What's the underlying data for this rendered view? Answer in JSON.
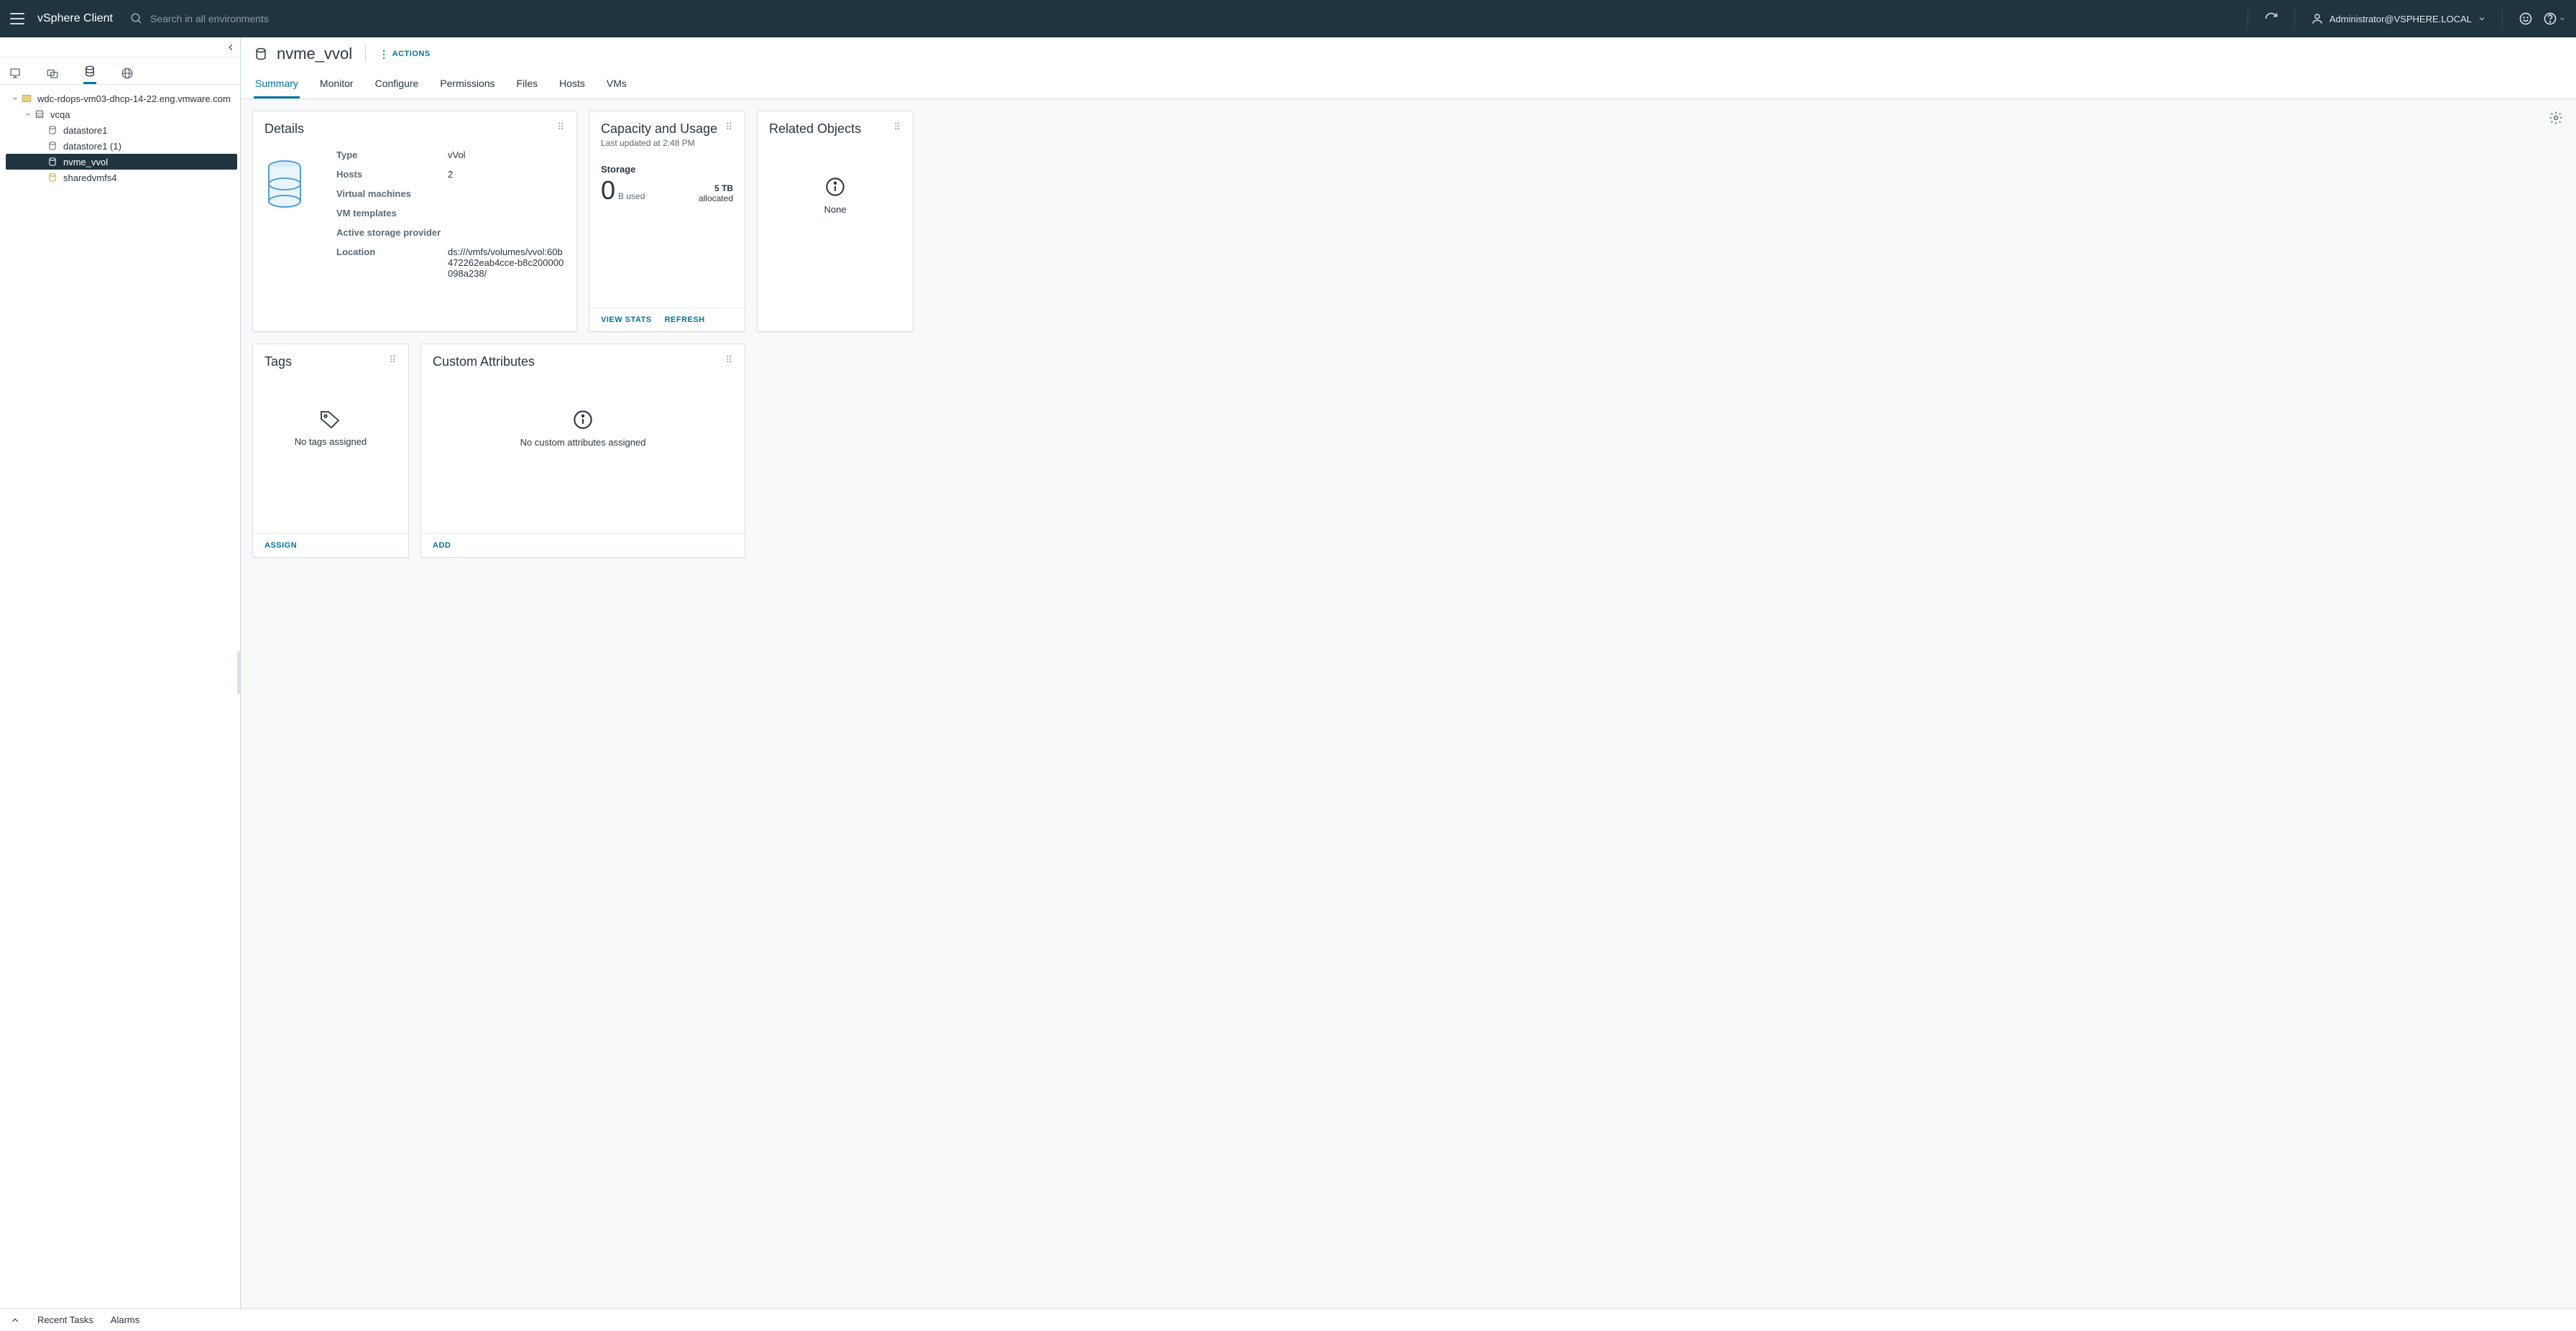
{
  "topbar": {
    "title": "vSphere Client",
    "search_placeholder": "Search in all environments",
    "user": "Administrator@VSPHERE.LOCAL"
  },
  "tree": {
    "vc": "wdc-rdops-vm03-dhcp-14-22.eng.vmware.com",
    "dc": "vcqa",
    "ds": [
      "datastore1",
      "datastore1 (1)",
      "nvme_vvol",
      "sharedvmfs4"
    ],
    "selected": "nvme_vvol"
  },
  "object": {
    "name": "nvme_vvol",
    "actions_label": "ACTIONS",
    "tabs": [
      "Summary",
      "Monitor",
      "Configure",
      "Permissions",
      "Files",
      "Hosts",
      "VMs"
    ],
    "active_tab": "Summary"
  },
  "details": {
    "title": "Details",
    "rows": [
      {
        "k": "Type",
        "v": "vVol"
      },
      {
        "k": "Hosts",
        "v": "2"
      },
      {
        "k": "Virtual machines",
        "v": ""
      },
      {
        "k": "VM templates",
        "v": ""
      },
      {
        "k": "Active storage provider",
        "v": ""
      },
      {
        "k": "Location",
        "v": "ds:///vmfs/volumes/vvol:60b472262eab4cce-b8c200000098a238/"
      }
    ]
  },
  "capacity": {
    "title": "Capacity and Usage",
    "updated": "Last updated at 2:48 PM",
    "storage_label": "Storage",
    "used_value": "0",
    "used_unit": "B used",
    "alloc_value": "5 TB",
    "alloc_label": "allocated",
    "view_stats": "VIEW STATS",
    "refresh": "REFRESH"
  },
  "related": {
    "title": "Related Objects",
    "none": "None"
  },
  "tags": {
    "title": "Tags",
    "empty": "No tags assigned",
    "assign": "ASSIGN"
  },
  "custom": {
    "title": "Custom Attributes",
    "empty": "No custom attributes assigned",
    "add": "ADD"
  },
  "bottom": {
    "recent": "Recent Tasks",
    "alarms": "Alarms"
  }
}
